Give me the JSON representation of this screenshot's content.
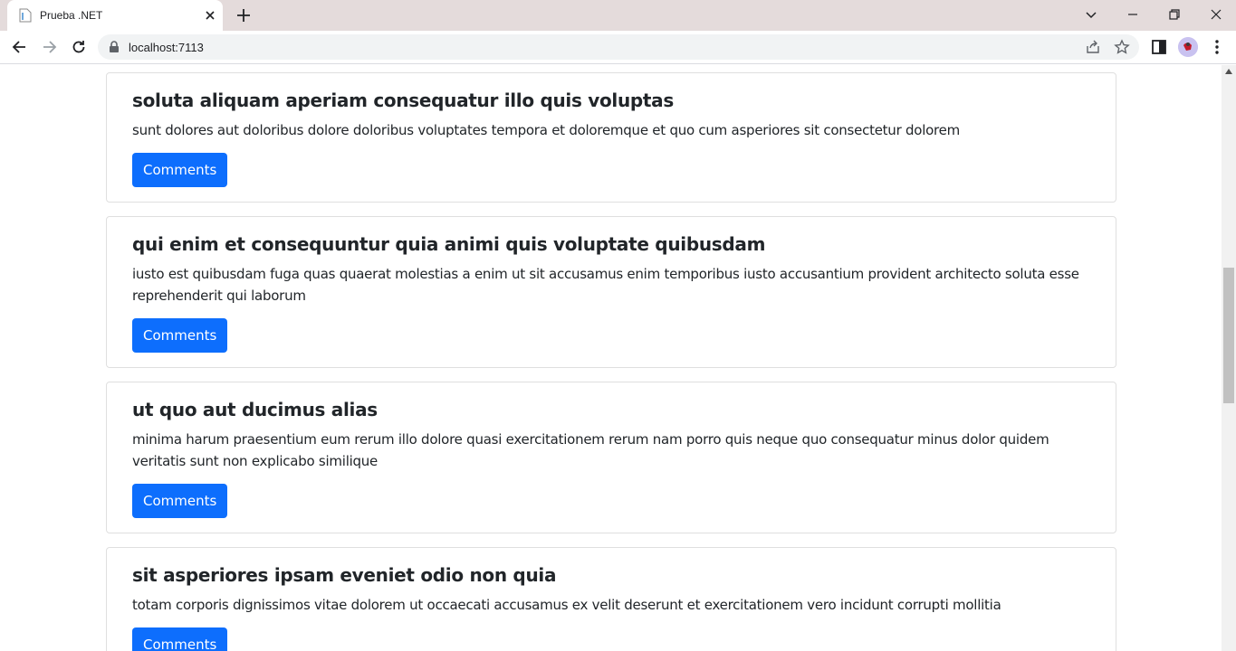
{
  "browser": {
    "tab_title": "Prueba .NET",
    "url": "localhost:7113"
  },
  "posts": [
    {
      "title": "soluta aliquam aperiam consequatur illo quis voluptas",
      "body": "sunt dolores aut doloribus dolore doloribus voluptates tempora et doloremque et quo cum asperiores sit consectetur dolorem",
      "button": "Comments"
    },
    {
      "title": "qui enim et consequuntur quia animi quis voluptate quibusdam",
      "body": "iusto est quibusdam fuga quas quaerat molestias a enim ut sit accusamus enim temporibus iusto accusantium provident architecto soluta esse reprehenderit qui laborum",
      "button": "Comments"
    },
    {
      "title": "ut quo aut ducimus alias",
      "body": "minima harum praesentium eum rerum illo dolore quasi exercitationem rerum nam porro quis neque quo consequatur minus dolor quidem veritatis sunt non explicabo similique",
      "button": "Comments"
    },
    {
      "title": "sit asperiores ipsam eveniet odio non quia",
      "body": "totam corporis dignissimos vitae dolorem ut occaecati accusamus ex velit deserunt et exercitationem vero incidunt corrupti mollitia",
      "button": "Comments"
    }
  ],
  "colors": {
    "primary_button": "#0d6efd",
    "tabstrip": "#e4dbdb"
  }
}
